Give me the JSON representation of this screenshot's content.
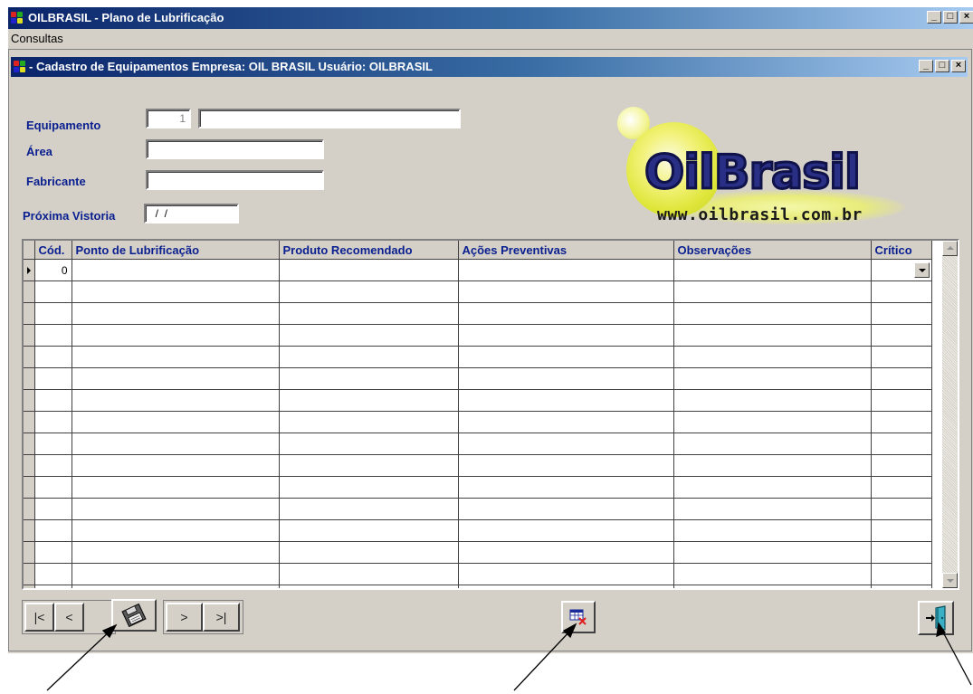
{
  "app": {
    "title": "OILBRASIL - Plano de Lubrificação",
    "caption_buttons": [
      "_",
      "□",
      "×"
    ]
  },
  "menu": {
    "items": [
      {
        "label": "Consultas"
      }
    ]
  },
  "child": {
    "title": "- Cadastro de Equipamentos   Empresa: OIL BRASIL   Usuário: OILBRASIL"
  },
  "form": {
    "equipamento_label": "Equipamento",
    "equipamento_code": "1",
    "equipamento_name": "",
    "area_label": "Área",
    "area_value": "",
    "fabricante_label": "Fabricante",
    "fabricante_value": "",
    "vistoria_label": "Próxima Vistoria",
    "vistoria_value": "  /  /"
  },
  "logo": {
    "name": "OilBrasil",
    "url": "www.oilbrasil.com.br"
  },
  "grid": {
    "columns": [
      "Cód.",
      "Ponto de Lubrificação",
      "Produto Recomendado",
      "Ações Preventivas",
      "Observações",
      "Crítico"
    ],
    "rows": [
      [
        "0",
        "",
        "",
        "",
        "",
        ""
      ]
    ],
    "empty_rows": 15
  },
  "toolbar": {
    "first_label": "|<",
    "prev_label": "<",
    "save_icon": "floppy-disk-icon",
    "next_label": ">",
    "last_label": ">|",
    "delete_icon": "delete-grid-row-icon",
    "exit_icon": "exit-door-icon"
  },
  "colors": {
    "title_start": "#0a246a",
    "title_end": "#a6caf0",
    "label_blue": "#0a1f8f",
    "window_face": "#d4d0c8",
    "logo_ball": "#dfe63a",
    "logo_text": "#2a2f86"
  }
}
